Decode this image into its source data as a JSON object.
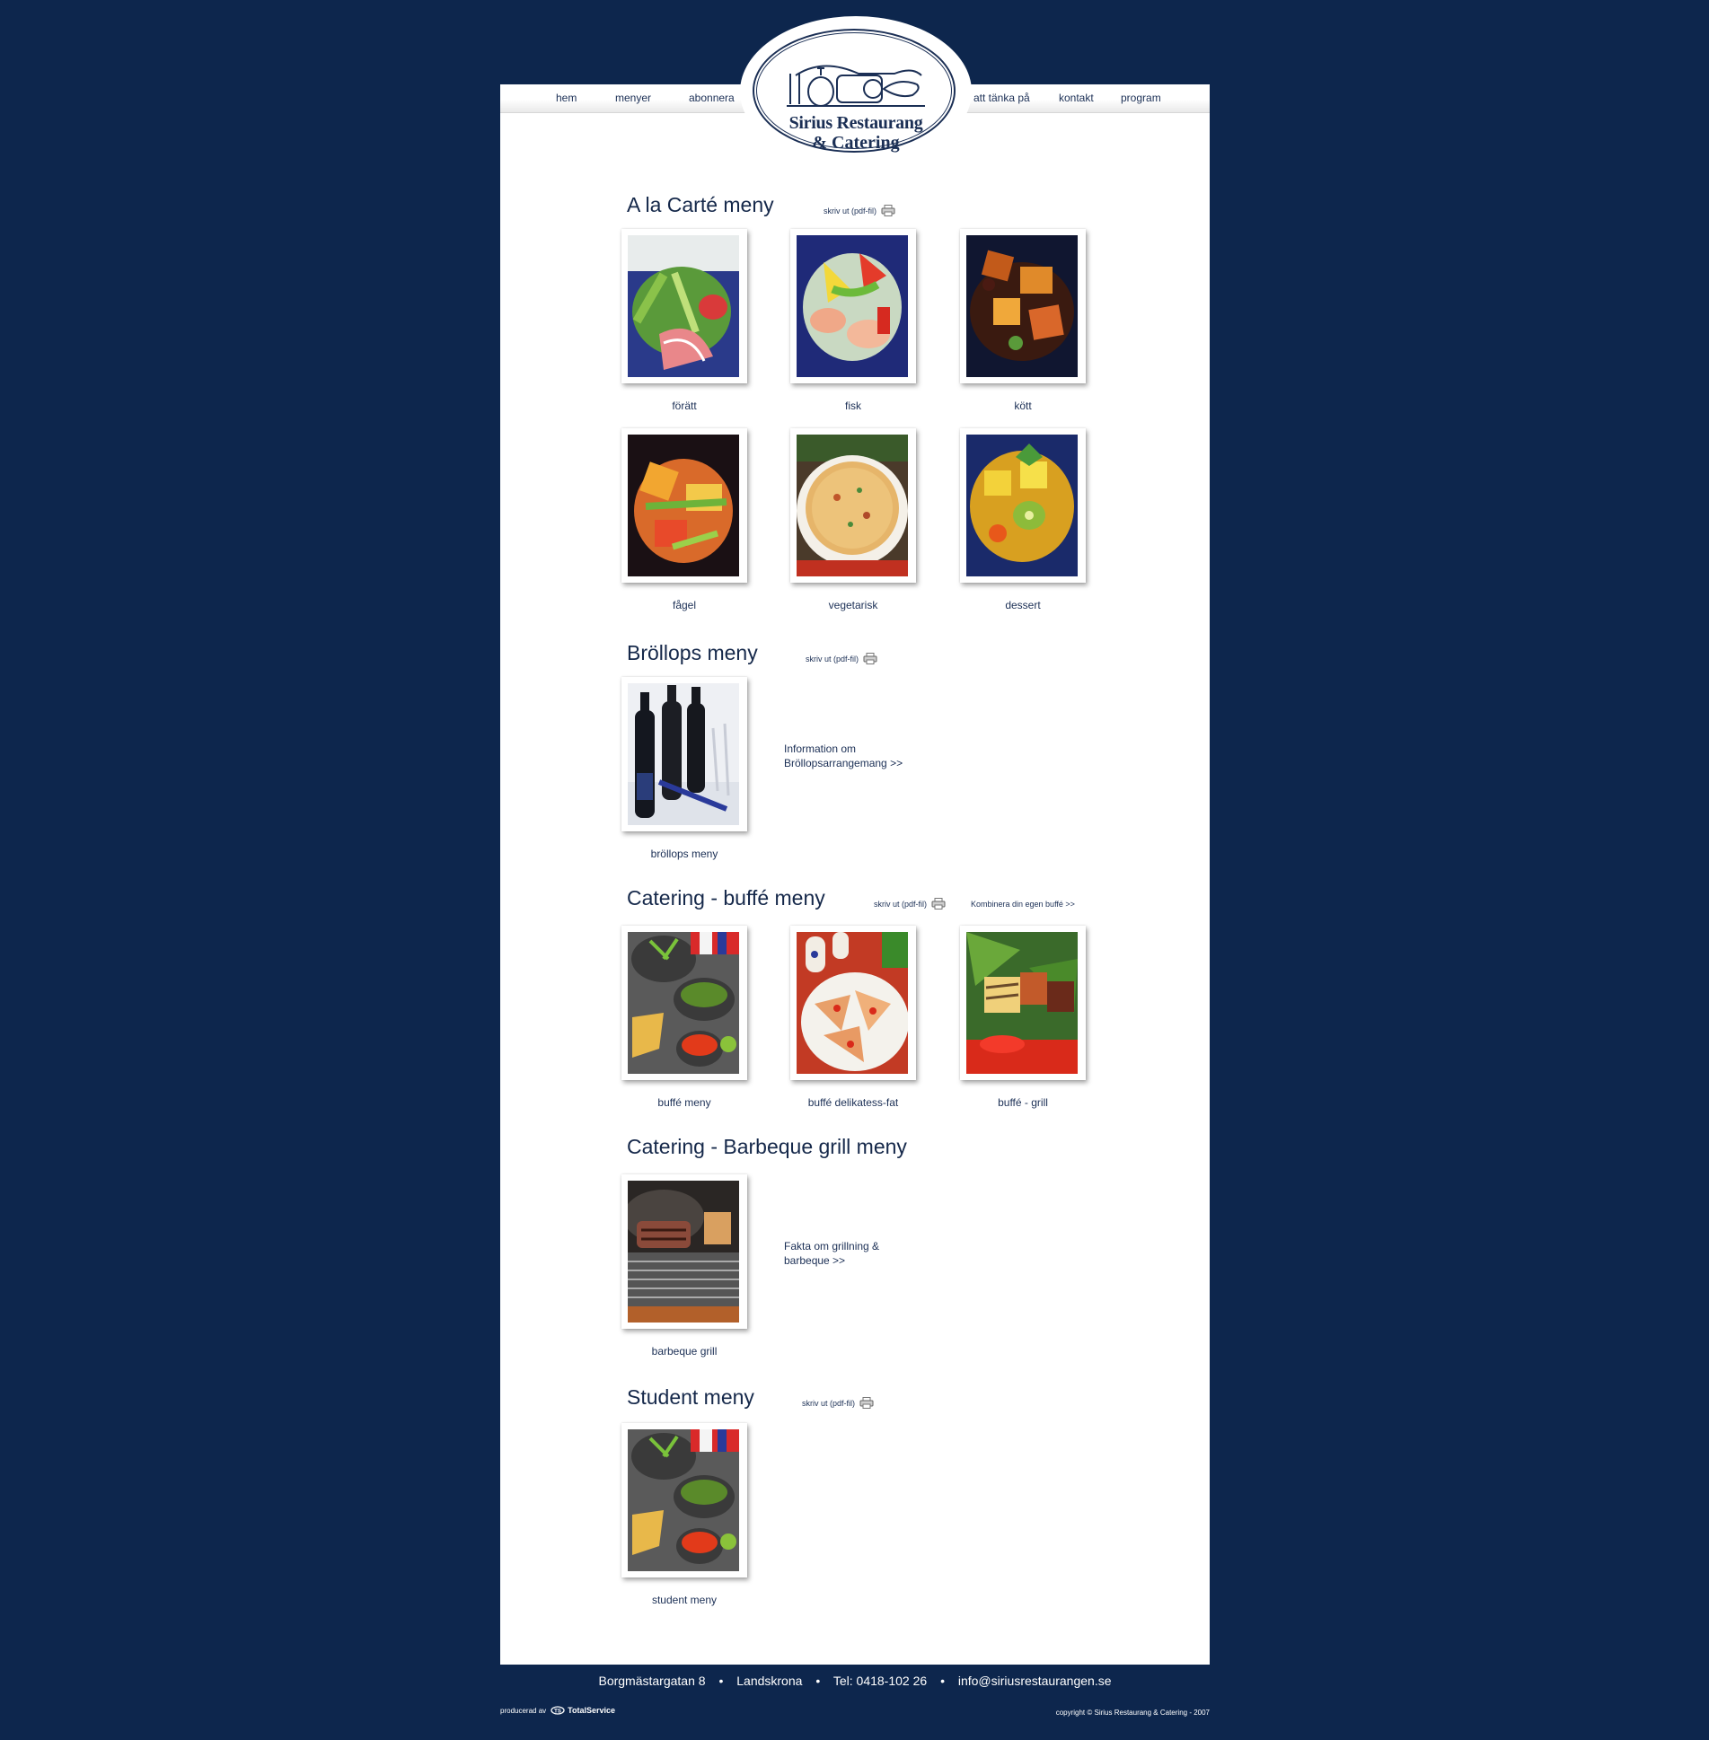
{
  "nav": {
    "left": [
      "hem",
      "menyer",
      "abonnera"
    ],
    "right": [
      "att tänka på",
      "kontakt",
      "program"
    ]
  },
  "logo": {
    "line1": "Sirius Restaurang",
    "line2": "& Catering"
  },
  "print_label": "skriv ut (pdf-fil)",
  "sections": {
    "alacarte": {
      "title": "A la Carté meny",
      "items": [
        "förätt",
        "fisk",
        "kött",
        "fågel",
        "vegetarisk",
        "dessert"
      ]
    },
    "brollop": {
      "title": "Bröllops meny",
      "items": [
        "bröllops meny"
      ],
      "info_line1": "Information om",
      "info_line2": "Bröllopsarrangemang >>"
    },
    "buffe": {
      "title": "Catering - buffé meny",
      "combine_link": "Kombinera din egen buffé >>",
      "items": [
        "buffé meny",
        "buffé delikatess-fat",
        "buffé - grill"
      ]
    },
    "bbq": {
      "title": "Catering - Barbeque grill meny",
      "items": [
        "barbeque grill"
      ],
      "info_line1": "Fakta om grillning &",
      "info_line2": "barbeque >>"
    },
    "student": {
      "title": "Student meny",
      "items": [
        "student meny"
      ]
    }
  },
  "footer": {
    "street": "Borgmästargatan 8",
    "city": "Landskrona",
    "phone": "Tel: 0418-102 26",
    "email": "info@siriusrestaurangen.se",
    "separator": "•",
    "produced_by": "producerad av",
    "producer_name": "TotalService",
    "copyright": "copyright © Sirius Restaurang & Catering - 2007"
  },
  "colors": {
    "background": "#0d264d",
    "page": "#ffffff",
    "text": "#15284a"
  }
}
